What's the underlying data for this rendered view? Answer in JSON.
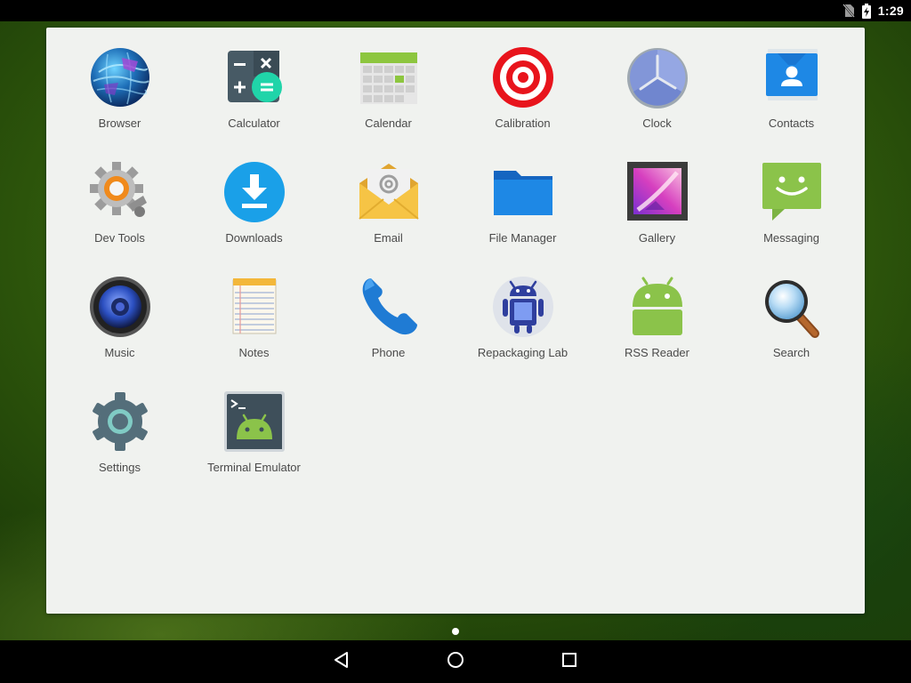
{
  "status_bar": {
    "time": "1:29",
    "icons": [
      "no-sim-icon",
      "battery-charging-icon"
    ]
  },
  "apps": [
    {
      "label": "Browser",
      "icon": "browser-globe-icon"
    },
    {
      "label": "Calculator",
      "icon": "calculator-icon"
    },
    {
      "label": "Calendar",
      "icon": "calendar-icon"
    },
    {
      "label": "Calibration",
      "icon": "calibration-target-icon"
    },
    {
      "label": "Clock",
      "icon": "clock-icon"
    },
    {
      "label": "Contacts",
      "icon": "contacts-icon"
    },
    {
      "label": "Dev Tools",
      "icon": "dev-tools-gear-icon"
    },
    {
      "label": "Downloads",
      "icon": "downloads-icon"
    },
    {
      "label": "Email",
      "icon": "email-envelope-icon"
    },
    {
      "label": "File Manager",
      "icon": "folder-icon"
    },
    {
      "label": "Gallery",
      "icon": "gallery-picture-icon"
    },
    {
      "label": "Messaging",
      "icon": "messaging-bubble-icon"
    },
    {
      "label": "Music",
      "icon": "music-speaker-icon"
    },
    {
      "label": "Notes",
      "icon": "notes-notepad-icon"
    },
    {
      "label": "Phone",
      "icon": "phone-handset-icon"
    },
    {
      "label": "Repackaging Lab",
      "icon": "repackaging-lab-icon"
    },
    {
      "label": "RSS Reader",
      "icon": "rss-reader-android-icon"
    },
    {
      "label": "Search",
      "icon": "search-magnifier-icon"
    },
    {
      "label": "Settings",
      "icon": "settings-gear-icon"
    },
    {
      "label": "Terminal Emulator",
      "icon": "terminal-emulator-icon"
    }
  ],
  "navigation": {
    "buttons": [
      "back-icon",
      "home-icon",
      "recents-icon"
    ]
  },
  "colors": {
    "drawer_background": "#f0f2ef",
    "label_text": "#4a4a4a",
    "bars": "#000000"
  }
}
